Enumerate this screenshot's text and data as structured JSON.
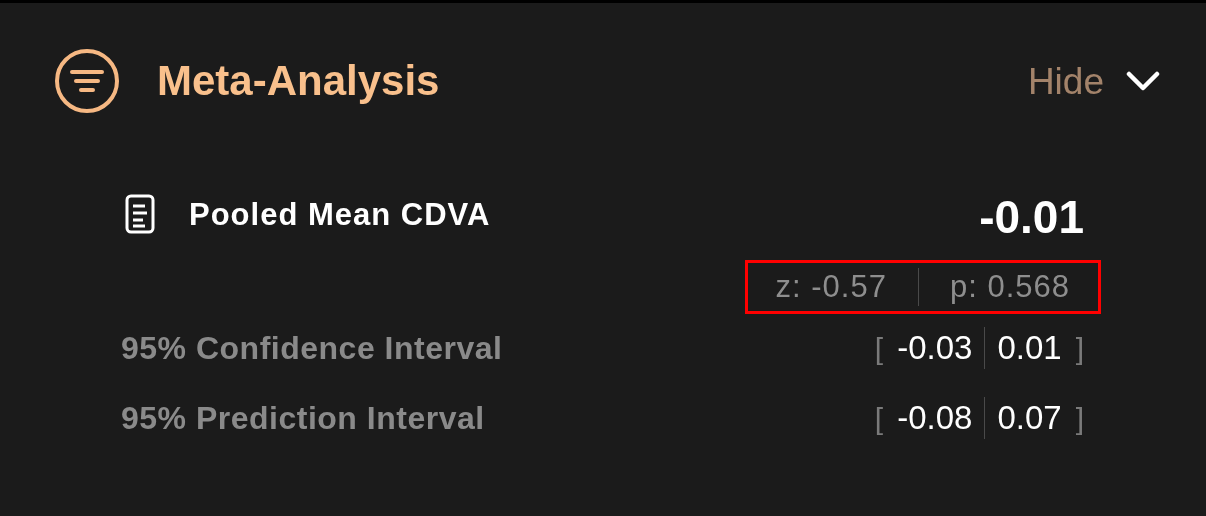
{
  "header": {
    "title": "Meta-Analysis",
    "toggle_label": "Hide",
    "expanded": true
  },
  "pooled": {
    "label": "Pooled Mean CDVA",
    "value": "-0.01",
    "stats": [
      {
        "text": "z: -0.57"
      },
      {
        "text": "p: 0.568"
      }
    ],
    "highlighted": true
  },
  "intervals": [
    {
      "label": "95% Confidence Interval",
      "open": "[",
      "lower": "-0.03",
      "upper": "0.01",
      "close": "]"
    },
    {
      "label": "95% Prediction Interval",
      "open": "[",
      "lower": "-0.08",
      "upper": "0.07",
      "close": "]"
    }
  ]
}
